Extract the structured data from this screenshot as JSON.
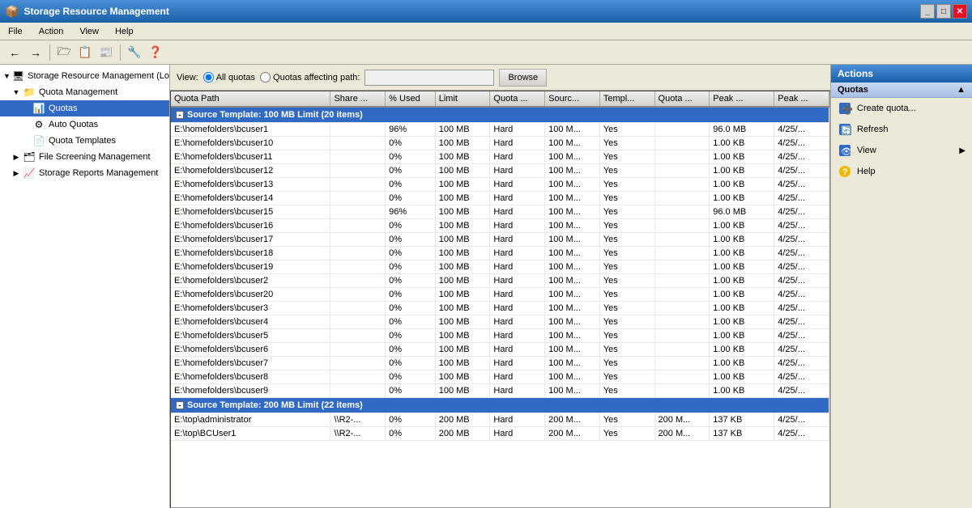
{
  "window": {
    "title": "Storage Resource Management",
    "icon": "📦"
  },
  "titlebar_controls": [
    "_",
    "□",
    "✕"
  ],
  "menu": {
    "items": [
      "File",
      "Action",
      "View",
      "Help"
    ]
  },
  "toolbar": {
    "buttons": [
      "←",
      "→",
      "🗁",
      "📋",
      "📰",
      "🔧",
      "❓"
    ]
  },
  "view_bar": {
    "label": "View:",
    "option1": "All quotas",
    "option2": "Quotas affecting path:",
    "path_placeholder": "",
    "browse_label": "Browse"
  },
  "table": {
    "columns": [
      "Quota Path",
      "Share ...",
      "% Used",
      "Limit",
      "Quota ...",
      "Sourc...",
      "Templ...",
      "Quota ...",
      "Peak ...",
      "Peak ..."
    ],
    "group1": {
      "label": "Source Template: 100 MB Limit (20 items)",
      "rows": [
        {
          "path": "E:\\homefolders\\bcuser1",
          "share": "",
          "pct": "96%",
          "limit": "100 MB",
          "quota_type": "Hard",
          "source": "100 M...",
          "template": "Yes",
          "quota2": "",
          "peak": "96.0 MB",
          "peak2": "4/25/..."
        },
        {
          "path": "E:\\homefolders\\bcuser10",
          "share": "",
          "pct": "0%",
          "limit": "100 MB",
          "quota_type": "Hard",
          "source": "100 M...",
          "template": "Yes",
          "quota2": "",
          "peak": "1.00 KB",
          "peak2": "4/25/..."
        },
        {
          "path": "E:\\homefolders\\bcuser11",
          "share": "",
          "pct": "0%",
          "limit": "100 MB",
          "quota_type": "Hard",
          "source": "100 M...",
          "template": "Yes",
          "quota2": "",
          "peak": "1.00 KB",
          "peak2": "4/25/..."
        },
        {
          "path": "E:\\homefolders\\bcuser12",
          "share": "",
          "pct": "0%",
          "limit": "100 MB",
          "quota_type": "Hard",
          "source": "100 M...",
          "template": "Yes",
          "quota2": "",
          "peak": "1.00 KB",
          "peak2": "4/25/..."
        },
        {
          "path": "E:\\homefolders\\bcuser13",
          "share": "",
          "pct": "0%",
          "limit": "100 MB",
          "quota_type": "Hard",
          "source": "100 M...",
          "template": "Yes",
          "quota2": "",
          "peak": "1.00 KB",
          "peak2": "4/25/..."
        },
        {
          "path": "E:\\homefolders\\bcuser14",
          "share": "",
          "pct": "0%",
          "limit": "100 MB",
          "quota_type": "Hard",
          "source": "100 M...",
          "template": "Yes",
          "quota2": "",
          "peak": "1.00 KB",
          "peak2": "4/25/..."
        },
        {
          "path": "E:\\homefolders\\bcuser15",
          "share": "",
          "pct": "96%",
          "limit": "100 MB",
          "quota_type": "Hard",
          "source": "100 M...",
          "template": "Yes",
          "quota2": "",
          "peak": "96.0 MB",
          "peak2": "4/25/..."
        },
        {
          "path": "E:\\homefolders\\bcuser16",
          "share": "",
          "pct": "0%",
          "limit": "100 MB",
          "quota_type": "Hard",
          "source": "100 M...",
          "template": "Yes",
          "quota2": "",
          "peak": "1.00 KB",
          "peak2": "4/25/..."
        },
        {
          "path": "E:\\homefolders\\bcuser17",
          "share": "",
          "pct": "0%",
          "limit": "100 MB",
          "quota_type": "Hard",
          "source": "100 M...",
          "template": "Yes",
          "quota2": "",
          "peak": "1.00 KB",
          "peak2": "4/25/..."
        },
        {
          "path": "E:\\homefolders\\bcuser18",
          "share": "",
          "pct": "0%",
          "limit": "100 MB",
          "quota_type": "Hard",
          "source": "100 M...",
          "template": "Yes",
          "quota2": "",
          "peak": "1.00 KB",
          "peak2": "4/25/..."
        },
        {
          "path": "E:\\homefolders\\bcuser19",
          "share": "",
          "pct": "0%",
          "limit": "100 MB",
          "quota_type": "Hard",
          "source": "100 M...",
          "template": "Yes",
          "quota2": "",
          "peak": "1.00 KB",
          "peak2": "4/25/..."
        },
        {
          "path": "E:\\homefolders\\bcuser2",
          "share": "",
          "pct": "0%",
          "limit": "100 MB",
          "quota_type": "Hard",
          "source": "100 M...",
          "template": "Yes",
          "quota2": "",
          "peak": "1.00 KB",
          "peak2": "4/25/..."
        },
        {
          "path": "E:\\homefolders\\bcuser20",
          "share": "",
          "pct": "0%",
          "limit": "100 MB",
          "quota_type": "Hard",
          "source": "100 M...",
          "template": "Yes",
          "quota2": "",
          "peak": "1.00 KB",
          "peak2": "4/25/..."
        },
        {
          "path": "E:\\homefolders\\bcuser3",
          "share": "",
          "pct": "0%",
          "limit": "100 MB",
          "quota_type": "Hard",
          "source": "100 M...",
          "template": "Yes",
          "quota2": "",
          "peak": "1.00 KB",
          "peak2": "4/25/..."
        },
        {
          "path": "E:\\homefolders\\bcuser4",
          "share": "",
          "pct": "0%",
          "limit": "100 MB",
          "quota_type": "Hard",
          "source": "100 M...",
          "template": "Yes",
          "quota2": "",
          "peak": "1.00 KB",
          "peak2": "4/25/..."
        },
        {
          "path": "E:\\homefolders\\bcuser5",
          "share": "",
          "pct": "0%",
          "limit": "100 MB",
          "quota_type": "Hard",
          "source": "100 M...",
          "template": "Yes",
          "quota2": "",
          "peak": "1.00 KB",
          "peak2": "4/25/..."
        },
        {
          "path": "E:\\homefolders\\bcuser6",
          "share": "",
          "pct": "0%",
          "limit": "100 MB",
          "quota_type": "Hard",
          "source": "100 M...",
          "template": "Yes",
          "quota2": "",
          "peak": "1.00 KB",
          "peak2": "4/25/..."
        },
        {
          "path": "E:\\homefolders\\bcuser7",
          "share": "",
          "pct": "0%",
          "limit": "100 MB",
          "quota_type": "Hard",
          "source": "100 M...",
          "template": "Yes",
          "quota2": "",
          "peak": "1.00 KB",
          "peak2": "4/25/..."
        },
        {
          "path": "E:\\homefolders\\bcuser8",
          "share": "",
          "pct": "0%",
          "limit": "100 MB",
          "quota_type": "Hard",
          "source": "100 M...",
          "template": "Yes",
          "quota2": "",
          "peak": "1.00 KB",
          "peak2": "4/25/..."
        },
        {
          "path": "E:\\homefolders\\bcuser9",
          "share": "",
          "pct": "0%",
          "limit": "100 MB",
          "quota_type": "Hard",
          "source": "100 M...",
          "template": "Yes",
          "quota2": "",
          "peak": "1.00 KB",
          "peak2": "4/25/..."
        }
      ]
    },
    "group2": {
      "label": "Source Template: 200 MB Limit (22 items)",
      "rows": [
        {
          "path": "E:\\top\\administrator",
          "share": "\\\\R2-...",
          "pct": "0%",
          "limit": "200 MB",
          "quota_type": "Hard",
          "source": "200 M...",
          "template": "Yes",
          "quota2": "200 M...",
          "peak": "137 KB",
          "peak2": "4/25/..."
        },
        {
          "path": "E:\\top\\BCUser1",
          "share": "\\\\R2-...",
          "pct": "0%",
          "limit": "200 MB",
          "quota_type": "Hard",
          "source": "200 M...",
          "template": "Yes",
          "quota2": "200 M...",
          "peak": "137 KB",
          "peak2": "4/25/..."
        }
      ]
    }
  },
  "tree": {
    "items": [
      {
        "label": "Storage Resource Management (Lo",
        "level": 0,
        "icon": "🖥",
        "expanded": true
      },
      {
        "label": "Quota Management",
        "level": 1,
        "icon": "📁",
        "expanded": true
      },
      {
        "label": "Quotas",
        "level": 2,
        "icon": "📊",
        "selected": true
      },
      {
        "label": "Auto Quotas",
        "level": 2,
        "icon": "⚙"
      },
      {
        "label": "Quota Templates",
        "level": 2,
        "icon": "📄"
      },
      {
        "label": "File Screening Management",
        "level": 1,
        "icon": "🗂",
        "expanded": false
      },
      {
        "label": "Storage Reports Management",
        "level": 1,
        "icon": "📈",
        "expanded": false
      }
    ]
  },
  "actions": {
    "header": "Actions",
    "sections": [
      {
        "label": "Quotas",
        "items": [
          {
            "label": "Create quota...",
            "icon": "➕"
          },
          {
            "label": "Refresh",
            "icon": "🔄"
          },
          {
            "label": "View",
            "icon": "👁",
            "has_arrow": true
          },
          {
            "label": "Help",
            "icon": "❓"
          }
        ]
      }
    ]
  }
}
